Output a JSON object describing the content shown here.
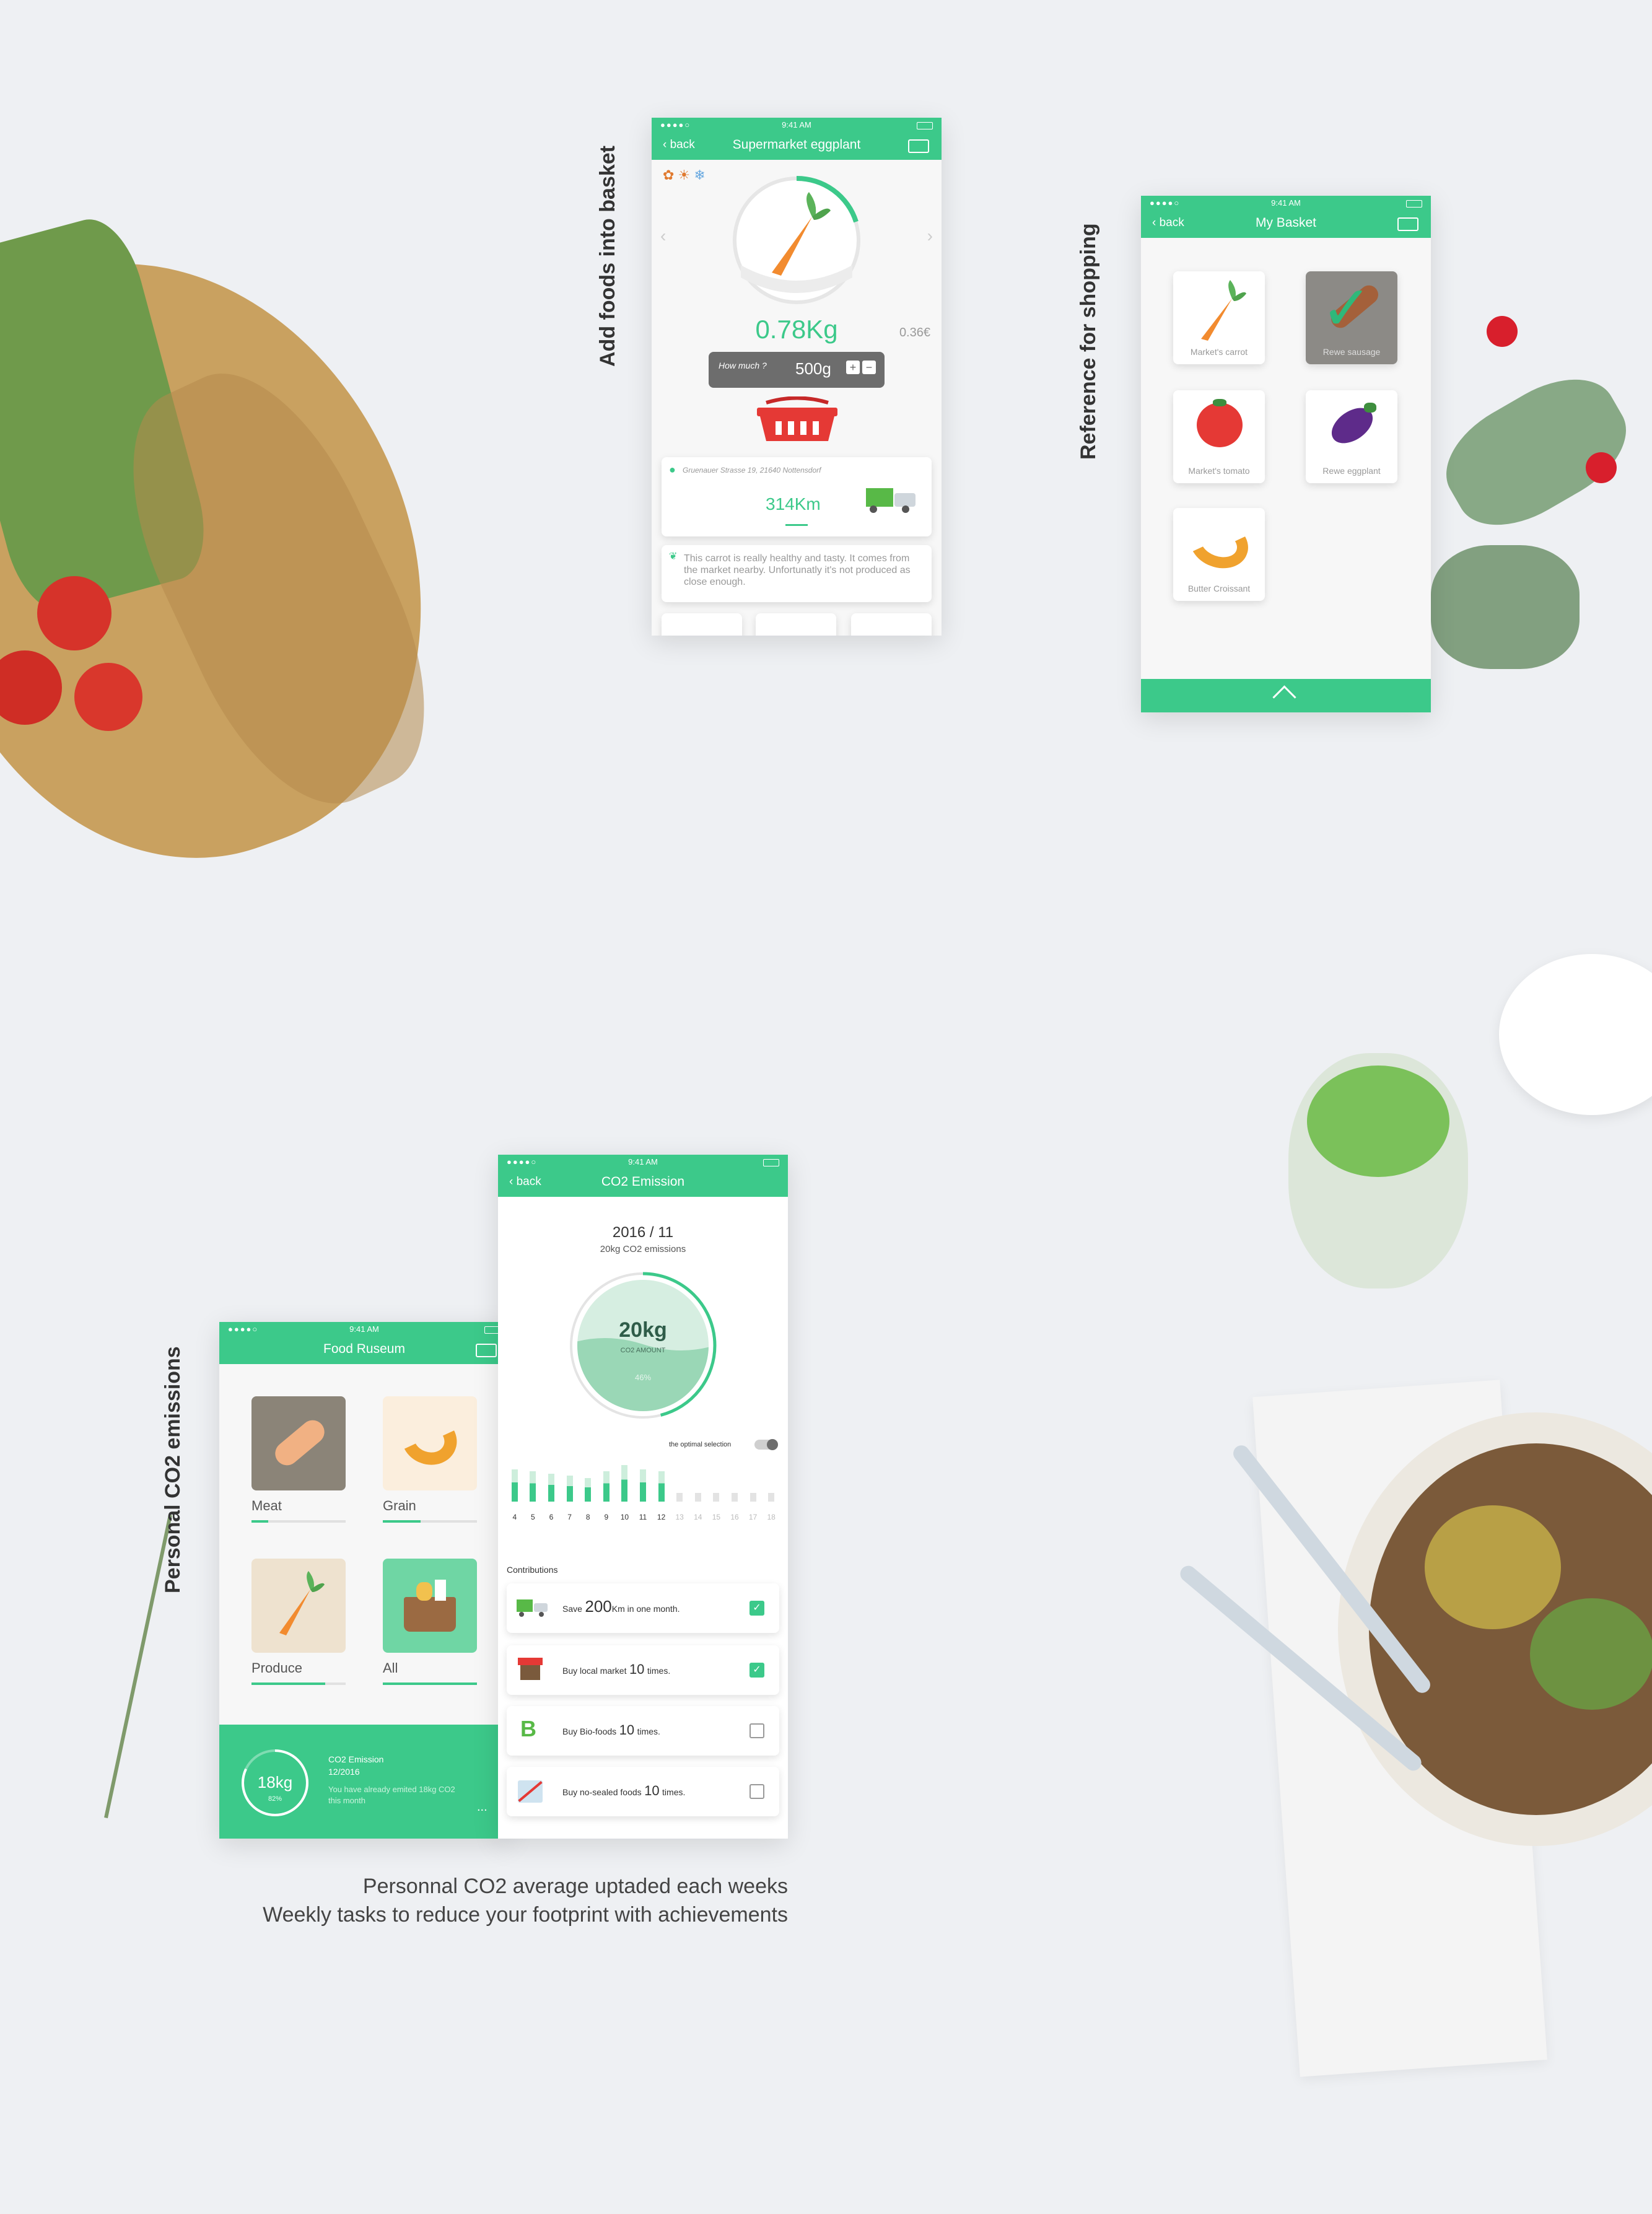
{
  "status_time": "9:41 AM",
  "labels": {
    "add_foods": "Add foods into basket",
    "reference": "Reference for shopping",
    "personal": "Personal CO2 emissions"
  },
  "caption": {
    "line1": "Personnal CO2 average uptaded each weeks",
    "line2": "Weekly tasks to reduce your footprint with achievements"
  },
  "screen1": {
    "back": "back",
    "title": "Supermarket eggplant",
    "weight": "0.78Kg",
    "price": "0.36€",
    "how_much": "How much ?",
    "amount": "500g",
    "plus": "+",
    "minus": "−",
    "address": "Gruenauer Strasse 19, 21640 Nottensdorf",
    "distance": "314Km",
    "description": "This carrot is really healthy and tasty. It comes from the market nearby. Unfortunatly it's not produced as close enough."
  },
  "screen2": {
    "back": "back",
    "title": "My Basket",
    "items": [
      "Market's carrot",
      "Rewe sausage",
      "Market's tomato",
      "Rewe eggplant",
      "Butter Croissant"
    ]
  },
  "screen3": {
    "title": "Food Ruseum",
    "categories": [
      "Meat",
      "Grain",
      "Produce",
      "All"
    ],
    "progress": [
      0.18,
      0.4,
      0.78,
      1.0
    ],
    "footer_value": "18kg",
    "footer_percent": "82%",
    "footer_title": "CO2 Emission",
    "footer_date": "12/2016",
    "footer_text": "You have already emited 18kg CO2 this month",
    "footer_more": "..."
  },
  "screen4": {
    "back": "back",
    "title": "CO2 Emission",
    "date": "2016 / 11",
    "subtitle": "20kg CO2 emissions",
    "circle_value": "20kg",
    "circle_label": "CO2 AMOUNT",
    "circle_percent": "46%",
    "toggle_label": "the optimal selection",
    "contributions_label": "Contributions",
    "tasks": [
      {
        "prefix": "Save",
        "big": "200",
        "suffix": "Km in one month.",
        "done": true
      },
      {
        "prefix": "Buy local market",
        "big": "10",
        "suffix": "times.",
        "done": true
      },
      {
        "prefix": "Buy Bio-foods",
        "big": "10",
        "suffix": "times.",
        "done": false
      },
      {
        "prefix": "Buy no-sealed foods",
        "big": "10",
        "suffix": "times.",
        "done": false
      }
    ]
  },
  "chart_data": {
    "type": "bar",
    "categories": [
      "4",
      "5",
      "6",
      "7",
      "8",
      "9",
      "10",
      "11",
      "12",
      "13",
      "14",
      "15",
      "16",
      "17",
      "18"
    ],
    "values": [
      0.75,
      0.7,
      0.65,
      0.6,
      0.55,
      0.7,
      0.85,
      0.75,
      0.7,
      0.2,
      0.2,
      0.2,
      0.2,
      0.2,
      0.2
    ],
    "ylim": [
      0,
      1
    ],
    "grid": false
  },
  "colors": {
    "accent": "#3cc98a",
    "background": "#eef0f3",
    "basket_red": "#e53935",
    "carrot": "#f28b2f"
  }
}
